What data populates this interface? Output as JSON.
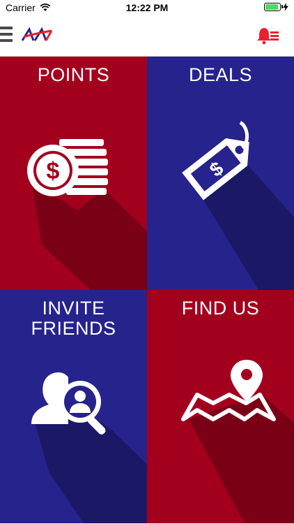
{
  "status_bar": {
    "carrier": "Carrier",
    "time": "12:22 PM"
  },
  "nav": {
    "menu_icon": "hamburger-icon",
    "logo": "AA",
    "notification_icon": "bell-list-icon",
    "accent_color": "#e8212e"
  },
  "tiles": [
    {
      "label": "POINTS",
      "icon": "coins-icon",
      "color": "#a3001e"
    },
    {
      "label": "DEALS",
      "icon": "price-tag-icon",
      "color": "#26238c"
    },
    {
      "label": "INVITE FRIENDS",
      "icon": "person-search-icon",
      "color": "#26238c"
    },
    {
      "label": "FIND US",
      "icon": "map-pin-icon",
      "color": "#a3001e"
    }
  ]
}
